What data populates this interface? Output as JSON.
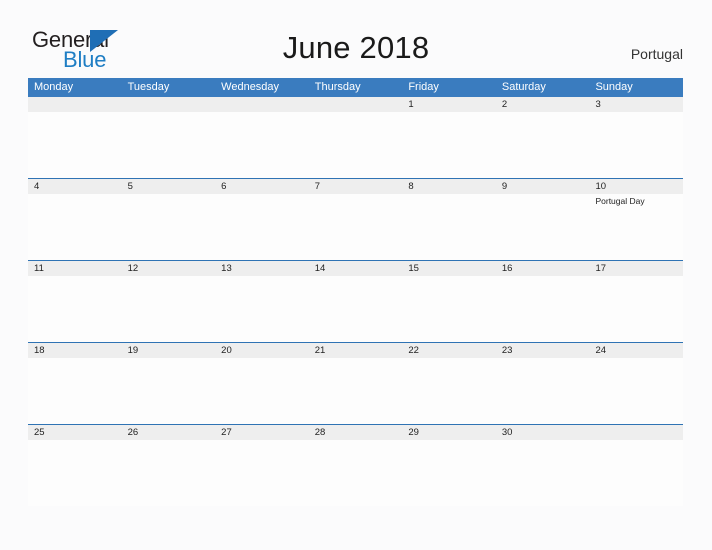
{
  "brand": {
    "line1": "General",
    "line2": "Blue",
    "triangle_icon": "brand-triangle-icon",
    "line1_color": "#231f20",
    "line2_color": "#1f7ec4",
    "triangle_color": "#1f6eb5"
  },
  "header": {
    "title": "June 2018",
    "country": "Portugal"
  },
  "theme": {
    "header_blue": "#3a7cbf",
    "row_divider_blue": "#2f73b4",
    "date_band_gray": "#eeeeee",
    "cell_white": "#fdfdfd",
    "page_background": "#fbfbfc"
  },
  "calendar": {
    "month": "June",
    "year": "2018",
    "weekday_headers": [
      "Monday",
      "Tuesday",
      "Wednesday",
      "Thursday",
      "Friday",
      "Saturday",
      "Sunday"
    ],
    "weeks": [
      {
        "days": [
          {
            "number": "",
            "events": []
          },
          {
            "number": "",
            "events": []
          },
          {
            "number": "",
            "events": []
          },
          {
            "number": "",
            "events": []
          },
          {
            "number": "1",
            "events": []
          },
          {
            "number": "2",
            "events": []
          },
          {
            "number": "3",
            "events": []
          }
        ]
      },
      {
        "days": [
          {
            "number": "4",
            "events": []
          },
          {
            "number": "5",
            "events": []
          },
          {
            "number": "6",
            "events": []
          },
          {
            "number": "7",
            "events": []
          },
          {
            "number": "8",
            "events": []
          },
          {
            "number": "9",
            "events": []
          },
          {
            "number": "10",
            "events": [
              "Portugal Day"
            ]
          }
        ]
      },
      {
        "days": [
          {
            "number": "11",
            "events": []
          },
          {
            "number": "12",
            "events": []
          },
          {
            "number": "13",
            "events": []
          },
          {
            "number": "14",
            "events": []
          },
          {
            "number": "15",
            "events": []
          },
          {
            "number": "16",
            "events": []
          },
          {
            "number": "17",
            "events": []
          }
        ]
      },
      {
        "days": [
          {
            "number": "18",
            "events": []
          },
          {
            "number": "19",
            "events": []
          },
          {
            "number": "20",
            "events": []
          },
          {
            "number": "21",
            "events": []
          },
          {
            "number": "22",
            "events": []
          },
          {
            "number": "23",
            "events": []
          },
          {
            "number": "24",
            "events": []
          }
        ]
      },
      {
        "days": [
          {
            "number": "25",
            "events": []
          },
          {
            "number": "26",
            "events": []
          },
          {
            "number": "27",
            "events": []
          },
          {
            "number": "28",
            "events": []
          },
          {
            "number": "29",
            "events": []
          },
          {
            "number": "30",
            "events": []
          },
          {
            "number": "",
            "events": []
          }
        ]
      }
    ]
  }
}
